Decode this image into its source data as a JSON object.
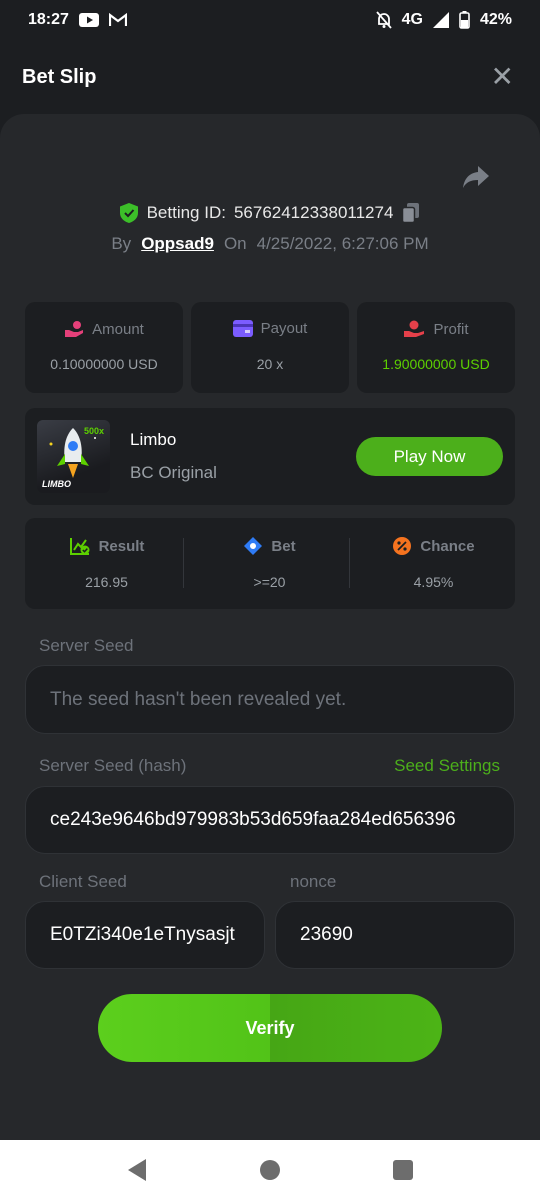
{
  "status_bar": {
    "time": "18:27",
    "network": "4G",
    "battery": "42%",
    "icons": [
      "youtube-icon",
      "gmail-icon",
      "mute-icon",
      "signal-icon",
      "battery-icon"
    ]
  },
  "header": {
    "title": "Bet Slip",
    "close_icon": "close-icon"
  },
  "bet": {
    "id_label": "Betting ID:",
    "id_value": "56762412338011274",
    "by_label": "By",
    "user": "Oppsad9",
    "on_label": "On",
    "datetime": "4/25/2022, 6:27:06 PM"
  },
  "stats": [
    {
      "label": "Amount",
      "value": "0.10000000 USD",
      "icon": "amount-icon",
      "icon_color": "#e5407a"
    },
    {
      "label": "Payout",
      "value": "20 x",
      "icon": "payout-icon",
      "icon_color": "#7b5cff"
    },
    {
      "label": "Profit",
      "value": "1.90000000 USD",
      "icon": "profit-icon",
      "icon_color": "#e5404a",
      "value_color": "#5dd000"
    }
  ],
  "game": {
    "name": "Limbo",
    "provider": "BC Original",
    "thumb_caption": "LIMBO",
    "thumb_badge": "500x",
    "play_label": "Play Now"
  },
  "info": [
    {
      "label": "Result",
      "value": "216.95",
      "icon": "chart-check-icon",
      "icon_color": "#5dd000"
    },
    {
      "label": "Bet",
      "value": ">=20",
      "icon": "tag-icon",
      "icon_color": "#2f7cf6"
    },
    {
      "label": "Chance",
      "value": "4.95%",
      "icon": "percent-icon",
      "icon_color": "#f5731f"
    }
  ],
  "server_seed": {
    "label": "Server Seed",
    "placeholder": "The seed hasn't been revealed yet."
  },
  "server_seed_hash": {
    "label": "Server Seed (hash)",
    "settings_link": "Seed Settings",
    "value": "ce243e9646bd979983b53d659faa284ed656396"
  },
  "client_seed": {
    "label": "Client Seed",
    "value": "E0TZi340e1eTnysasjt"
  },
  "nonce": {
    "label": "nonce",
    "value": "23690"
  },
  "verify_label": "Verify",
  "colors": {
    "accent_green": "#4caf1b",
    "background": "#1c1e21",
    "sheet": "#26282b"
  }
}
